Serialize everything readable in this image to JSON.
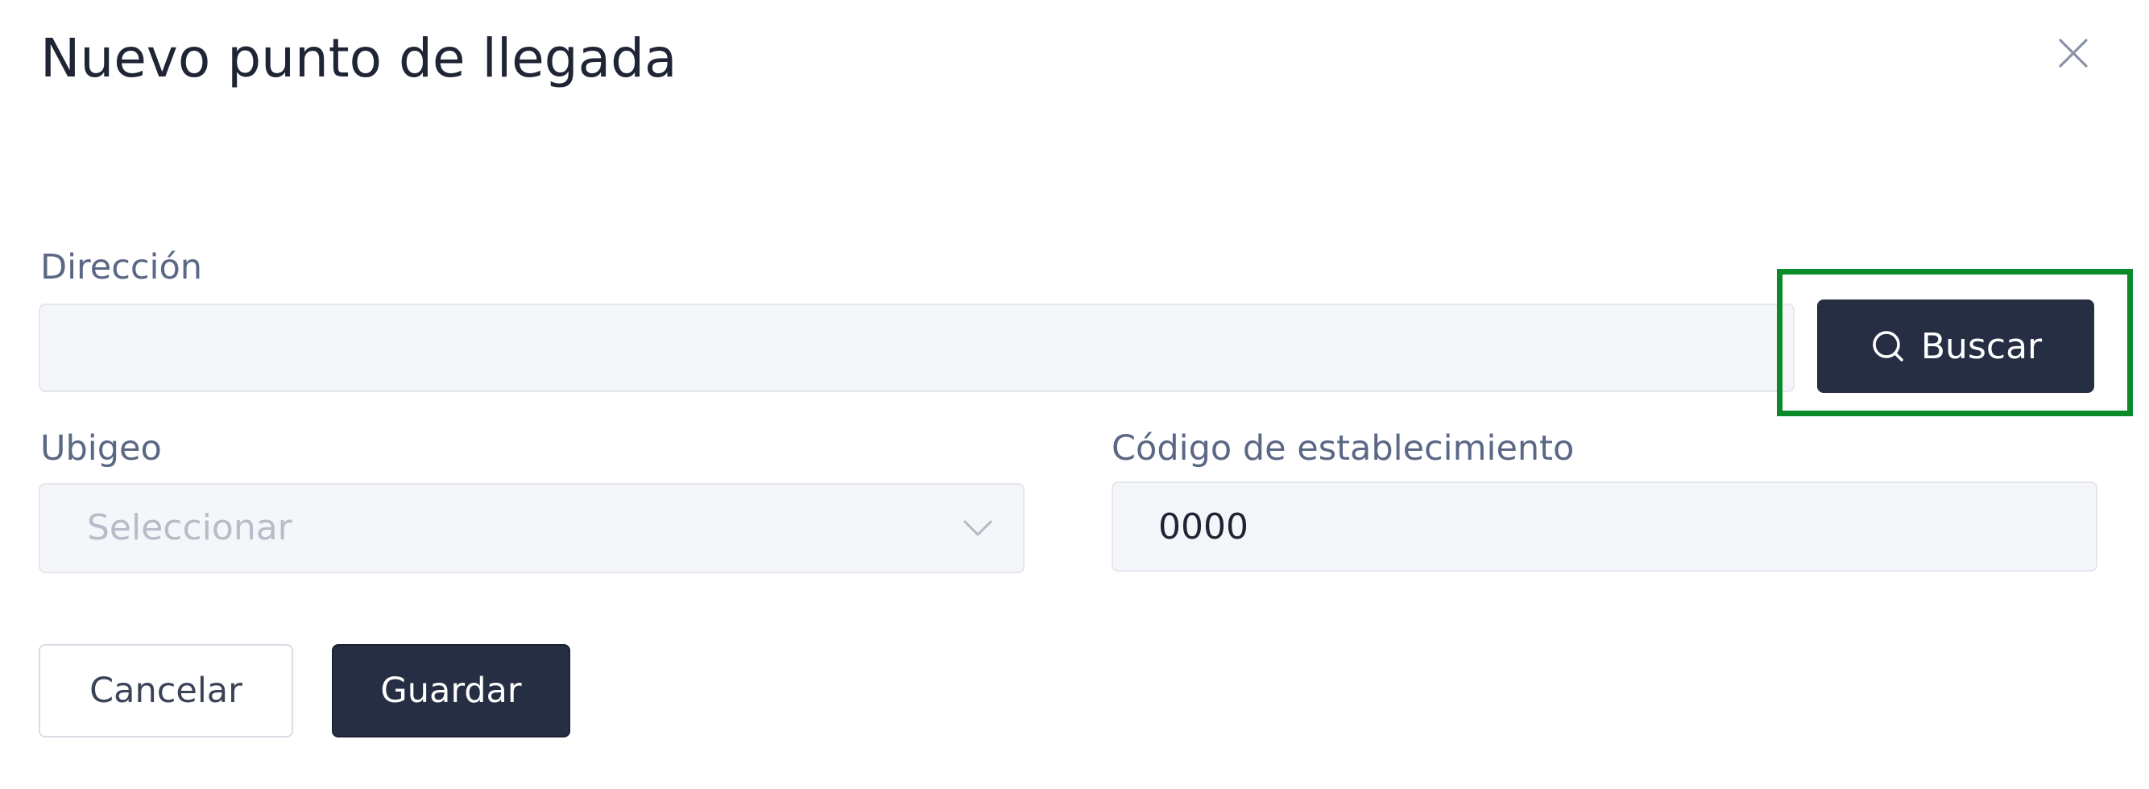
{
  "dialog": {
    "title": "Nuevo punto de llegada",
    "close_icon": "close-icon"
  },
  "form": {
    "direccion": {
      "label": "Dirección",
      "value": "",
      "placeholder": ""
    },
    "buscar_button": {
      "label": "Buscar",
      "icon": "search-icon"
    },
    "ubigeo": {
      "label": "Ubigeo",
      "placeholder": "Seleccionar",
      "icon": "chevron-down-icon"
    },
    "codigo_establecimiento": {
      "label": "Código de establecimiento",
      "value": "0000"
    }
  },
  "actions": {
    "cancel_label": "Cancelar",
    "save_label": "Guardar"
  },
  "colors": {
    "primary_button": "#262e44",
    "highlight": "#0b8a2a",
    "label": "#5a6785",
    "input_bg": "#f5f6f9"
  }
}
